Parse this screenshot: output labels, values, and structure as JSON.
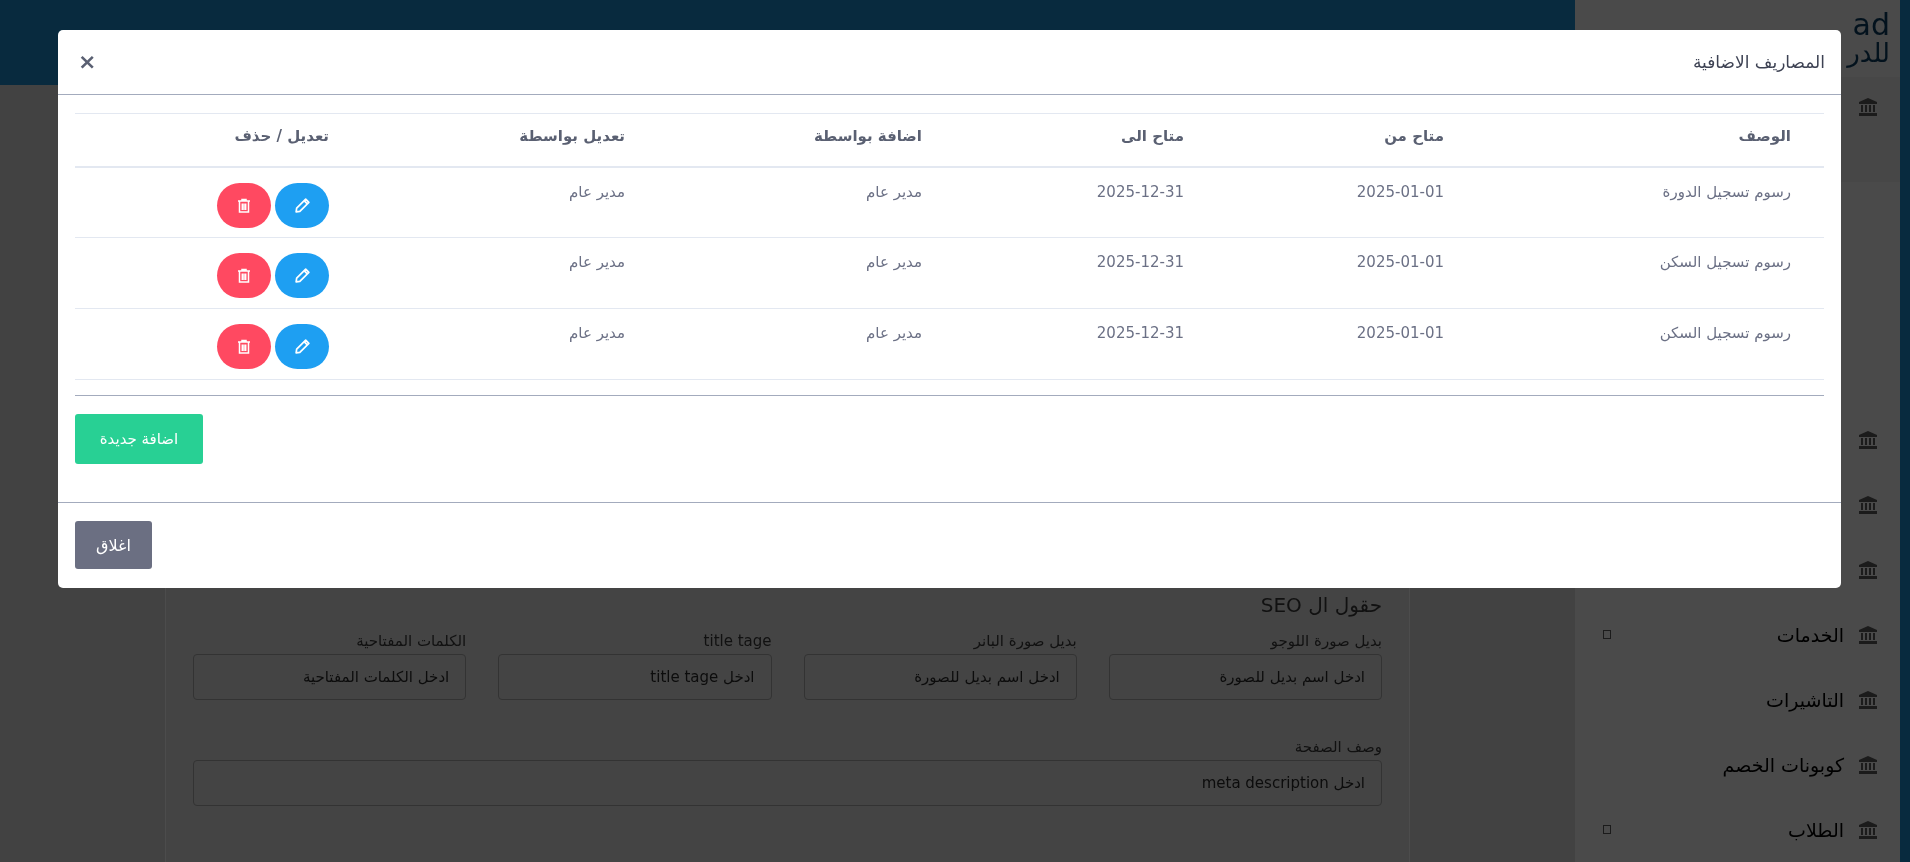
{
  "top_bar": {
    "logo": {
      "line_1": "ad",
      "line_2": "للدر"
    }
  },
  "sidebar": {
    "items": [
      {
        "has_submenu": false
      },
      {
        "has_submenu": false
      },
      {
        "has_submenu": false
      },
      {
        "label": "الخدمات",
        "has_submenu": true
      },
      {
        "label": "التاشيرات",
        "has_submenu": false
      },
      {
        "label": "كوبونات الخصم",
        "has_submenu": false
      },
      {
        "label": "الطلاب",
        "has_submenu": true
      }
    ]
  },
  "page_form": {
    "heading": "حقول ال SEO",
    "fields": [
      {
        "label": "بديل صورة اللوجو",
        "placeholder": "ادخل اسم بديل للصورة"
      },
      {
        "label": "بديل صورة البانر",
        "placeholder": "ادخل اسم بديل للصورة"
      },
      {
        "label": "title tage",
        "placeholder": "ادخل title tage"
      },
      {
        "label": "الكلمات المفتاحية",
        "placeholder": "ادخل الكلمات المفتاحية"
      }
    ],
    "description_field": {
      "label": "وصف الصفحة",
      "placeholder": "ادخل meta description"
    }
  },
  "modal": {
    "title": "المصاريف الاضافية",
    "close_icon": "×",
    "table": {
      "columns": [
        "الوصف",
        "متاح من",
        "متاح الى",
        "اضافة بواسطة",
        "تعديل بواسطة",
        "تعديل / حذف"
      ],
      "rows": [
        {
          "cells": [
            "رسوم تسجيل الدورة",
            "2025-01-01",
            "2025-12-31",
            "مدير عام",
            "مدير عام"
          ]
        },
        {
          "cells": [
            "رسوم تسجيل السكن",
            "2025-01-01",
            "2025-12-31",
            "مدير عام",
            "مدير عام"
          ]
        },
        {
          "cells": [
            "رسوم تسجيل السكن",
            "2025-01-01",
            "2025-12-31",
            "مدير عام",
            "مدير عام"
          ]
        }
      ]
    },
    "add_button": "اضافة جديدة",
    "close_button": "اغلاق"
  }
}
